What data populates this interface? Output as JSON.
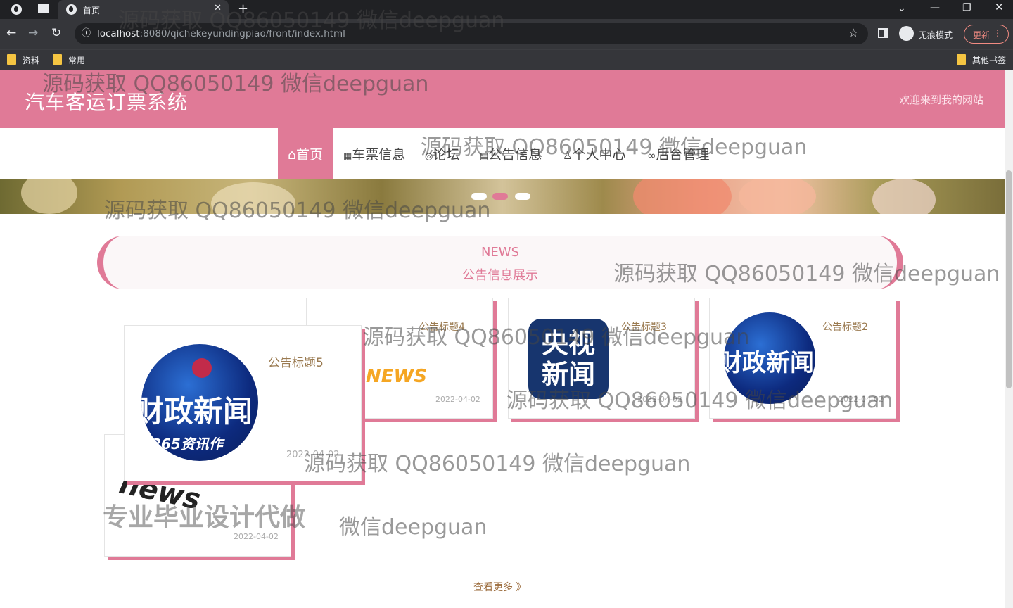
{
  "browser": {
    "tab_title": "首页",
    "url_host": "localhost",
    "url_path": ":8080/qichekeyundingpiao/front/index.html",
    "incognito_label": "无痕模式",
    "update_label": "更新",
    "bookmarks": [
      "资料",
      "常用"
    ],
    "other_bookmarks": "其他书签"
  },
  "site": {
    "title": "汽车客运订票系统",
    "welcome": "欢迎来到我的网站"
  },
  "nav": [
    {
      "icon": "⌂",
      "label": "首页"
    },
    {
      "icon": "▦",
      "label": "车票信息"
    },
    {
      "icon": "◎",
      "label": "论坛"
    },
    {
      "icon": "▤",
      "label": "公告信息"
    },
    {
      "icon": "♙",
      "label": "个人中心"
    },
    {
      "icon": "∞",
      "label": "后台管理"
    }
  ],
  "news_section": {
    "title_en": "NEWS",
    "title_cn": "公告信息展示",
    "more": "查看更多 》"
  },
  "cards": [
    {
      "title": "公告标题5",
      "date": "2022-04-02",
      "image": "finance-news-image"
    },
    {
      "title": "公告标题4",
      "date": "2022-04-02",
      "image": "news-3d-image"
    },
    {
      "title": "公告标题3",
      "date": "2022-04-02",
      "image": "cctv-news-image"
    },
    {
      "title": "公告标题2",
      "date": "2022-04-02",
      "image": "finance-news-image"
    },
    {
      "title": "",
      "date": "2022-04-02",
      "image": "news-newspaper-image"
    }
  ],
  "image_text": {
    "cctv": "央视\n新闻",
    "finance": "财政新闻",
    "finance_sub": "265资讯作",
    "news": "NEWS",
    "news_paper": "news"
  },
  "watermark": "源码获取 QQ86050149 微信deepguan",
  "overlay_text": "专业毕业设计代做",
  "overlay_suffix": "微信deepguan",
  "colors": {
    "accent": "#e07a97",
    "chrome": "#35363a"
  }
}
